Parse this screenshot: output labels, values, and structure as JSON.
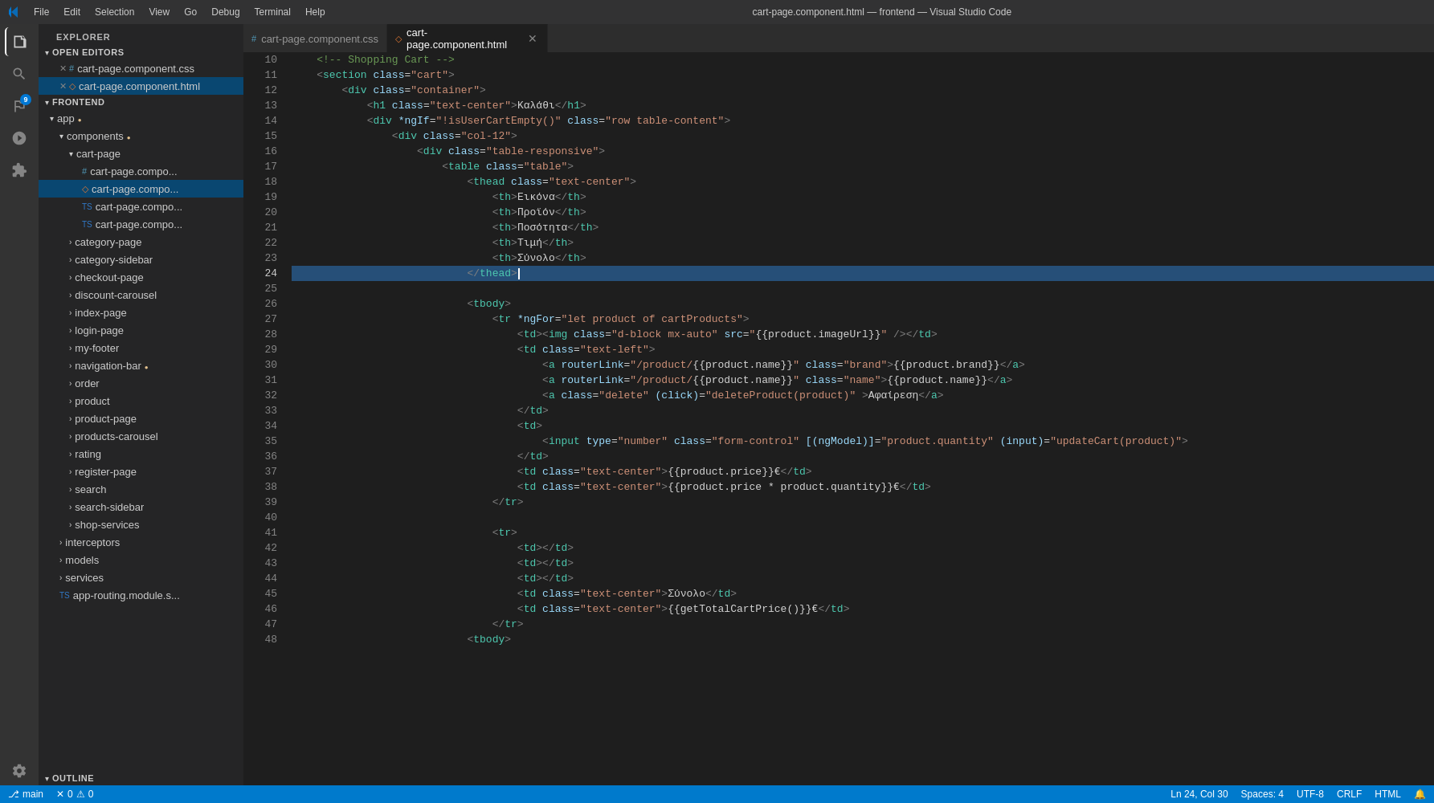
{
  "titleBar": {
    "title": "cart-page.component.html — frontend — Visual Studio Code",
    "menus": [
      "File",
      "Edit",
      "Selection",
      "View",
      "Go",
      "Debug",
      "Terminal",
      "Help"
    ]
  },
  "activityBar": {
    "icons": [
      {
        "name": "explorer-icon",
        "symbol": "⎘",
        "active": true,
        "badge": false
      },
      {
        "name": "search-activity-icon",
        "symbol": "🔍",
        "active": false,
        "badge": false
      },
      {
        "name": "source-control-icon",
        "symbol": "⎇",
        "active": false,
        "badge": true,
        "badgeCount": "9"
      },
      {
        "name": "debug-icon",
        "symbol": "▶",
        "active": false,
        "badge": false
      },
      {
        "name": "extensions-icon",
        "symbol": "⊞",
        "active": false,
        "badge": false
      }
    ],
    "bottomIcons": [
      {
        "name": "settings-icon",
        "symbol": "⚙",
        "active": false
      }
    ]
  },
  "sidebar": {
    "header": "Explorer",
    "openEditors": {
      "label": "Open Editors",
      "items": [
        {
          "icon": "css",
          "name": "cart-page.component.css",
          "prefix": "#",
          "closeBtn": true
        },
        {
          "icon": "html",
          "name": "cart-page.component.html",
          "prefix": "◇",
          "closeBtn": true,
          "active": true
        }
      ]
    },
    "frontend": {
      "label": "Frontend",
      "app": {
        "label": "app",
        "modified": true,
        "children": [
          {
            "label": "components",
            "modified": true,
            "children": [
              {
                "label": "cart-page",
                "children": [
                  {
                    "icon": "css",
                    "label": "cart-page.compo...",
                    "prefix": "#"
                  },
                  {
                    "icon": "html",
                    "label": "cart-page.compo...",
                    "prefix": "◇",
                    "active": true
                  },
                  {
                    "icon": "ts",
                    "label": "cart-page.compo...",
                    "prefix": "TS"
                  },
                  {
                    "icon": "ts",
                    "label": "cart-page.compo...",
                    "prefix": "TS"
                  }
                ]
              },
              {
                "label": "category-page",
                "collapsed": true
              },
              {
                "label": "category-sidebar",
                "collapsed": true
              },
              {
                "label": "checkout-page",
                "collapsed": true
              },
              {
                "label": "discount-carousel",
                "collapsed": true
              },
              {
                "label": "index-page",
                "collapsed": true
              },
              {
                "label": "login-page",
                "collapsed": true
              },
              {
                "label": "my-footer",
                "collapsed": true
              },
              {
                "label": "navigation-bar",
                "collapsed": true,
                "modified": true
              },
              {
                "label": "order",
                "collapsed": true
              },
              {
                "label": "product",
                "collapsed": true
              },
              {
                "label": "product-page",
                "collapsed": true
              },
              {
                "label": "products-carousel",
                "collapsed": true
              },
              {
                "label": "rating",
                "collapsed": true
              },
              {
                "label": "register-page",
                "collapsed": true
              },
              {
                "label": "search",
                "collapsed": true
              },
              {
                "label": "search-sidebar",
                "collapsed": true
              },
              {
                "label": "shop-services",
                "collapsed": true
              }
            ]
          },
          {
            "label": "interceptors",
            "collapsed": true
          },
          {
            "label": "models",
            "collapsed": true
          },
          {
            "label": "services",
            "collapsed": true
          },
          {
            "icon": "ts",
            "label": "app-routing.module.s...",
            "prefix": "TS"
          }
        ]
      }
    },
    "outline": {
      "label": "Outline"
    }
  },
  "tabs": [
    {
      "label": "cart-page.component.css",
      "icon": "css",
      "active": false
    },
    {
      "label": "cart-page.component.html",
      "icon": "html",
      "active": true,
      "closeable": true
    }
  ],
  "code": {
    "lines": [
      {
        "num": 10,
        "content": "    <!-- Shopping Cart -->"
      },
      {
        "num": 11,
        "content": "    <section class=\"cart\">"
      },
      {
        "num": 12,
        "content": "        <div class=\"container\">"
      },
      {
        "num": 13,
        "content": "            <h1 class=\"text-center\">Καλάθι</h1>"
      },
      {
        "num": 14,
        "content": "            <div *ngIf=\"!isUserCartEmpty()\" class=\"row table-content\">"
      },
      {
        "num": 15,
        "content": "                <div class=\"col-12\">"
      },
      {
        "num": 16,
        "content": "                    <div class=\"table-responsive\">"
      },
      {
        "num": 17,
        "content": "                        <table class=\"table\">"
      },
      {
        "num": 18,
        "content": "                            <thead class=\"text-center\">"
      },
      {
        "num": 19,
        "content": "                                <th>Εικόνα</th>"
      },
      {
        "num": 20,
        "content": "                                <th>Προϊόν</th>"
      },
      {
        "num": 21,
        "content": "                                <th>Ποσότητα</th>"
      },
      {
        "num": 22,
        "content": "                                <th>Τιμή</th>"
      },
      {
        "num": 23,
        "content": "                                <th>Σύνολο</th>"
      },
      {
        "num": 24,
        "content": "                            </thead>",
        "highlighted": true
      },
      {
        "num": 25,
        "content": ""
      },
      {
        "num": 26,
        "content": "                            <tbody>"
      },
      {
        "num": 27,
        "content": "                                <tr *ngFor=\"let product of cartProducts\">"
      },
      {
        "num": 28,
        "content": "                                    <td><img class=\"d-block mx-auto\" src=\"{{product.imageUrl}}\" /></td>"
      },
      {
        "num": 29,
        "content": "                                    <td class=\"text-left\">"
      },
      {
        "num": 30,
        "content": "                                        <a routerLink=\"/product/{{product.name}}\" class=\"brand\">{{product.brand}}</a>"
      },
      {
        "num": 31,
        "content": "                                        <a routerLink=\"/product/{{product.name}}\" class=\"name\">{{product.name}}</a>"
      },
      {
        "num": 32,
        "content": "                                        <a class=\"delete\" (click)=\"deleteProduct(product)\" >Αφαίρεση</a>"
      },
      {
        "num": 33,
        "content": "                                    </td>"
      },
      {
        "num": 34,
        "content": "                                    <td>"
      },
      {
        "num": 35,
        "content": "                                        <input type=\"number\" class=\"form-control\" [(ngModel)]=\"product.quantity\" (input)=\"updateCart(product)\">"
      },
      {
        "num": 36,
        "content": "                                    </td>"
      },
      {
        "num": 37,
        "content": "                                    <td class=\"text-center\">{{product.price}}€</td>"
      },
      {
        "num": 38,
        "content": "                                    <td class=\"text-center\">{{product.price * product.quantity}}€</td>"
      },
      {
        "num": 39,
        "content": "                                </tr>"
      },
      {
        "num": 40,
        "content": ""
      },
      {
        "num": 41,
        "content": "                                <tr>"
      },
      {
        "num": 42,
        "content": "                                    <td></td>"
      },
      {
        "num": 43,
        "content": "                                    <td></td>"
      },
      {
        "num": 44,
        "content": "                                    <td></td>"
      },
      {
        "num": 45,
        "content": "                                    <td class=\"text-center\">Σύνολο</td>"
      },
      {
        "num": 46,
        "content": "                                    <td class=\"text-center\">{{getTotalCartPrice()}}€</td>"
      },
      {
        "num": 47,
        "content": "                                </tr>"
      },
      {
        "num": 48,
        "content": "                            <tbody>"
      }
    ]
  },
  "statusBar": {
    "branch": "main",
    "errors": "0",
    "warnings": "0",
    "line": "Ln 24, Col 30",
    "spaces": "Spaces: 4",
    "encoding": "UTF-8",
    "lineEnding": "CRLF",
    "language": "HTML",
    "feedback": "🔔"
  }
}
